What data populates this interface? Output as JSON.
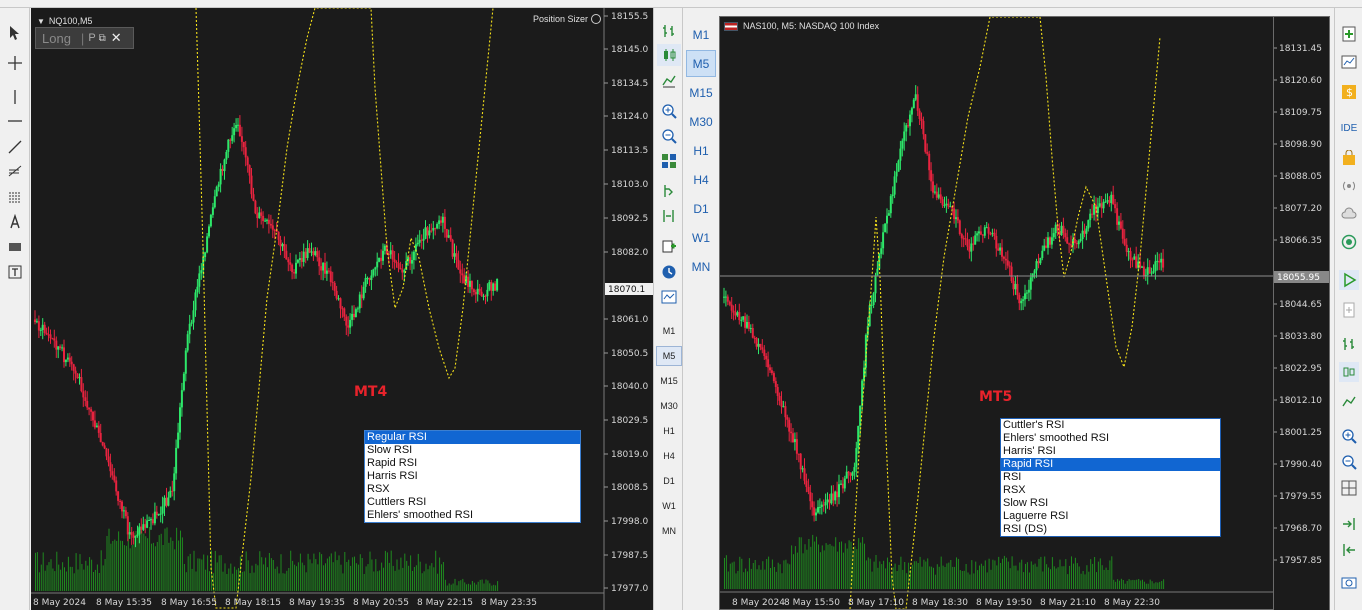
{
  "mt4": {
    "symbol_title": "NQ100,M5",
    "position_sizer": "Position Sizer",
    "panel": {
      "direction": "Long",
      "mode": "P"
    },
    "watermark": "MT4",
    "current_price": "18070.1",
    "price_axis": [
      "18155.5",
      "18145.0",
      "18134.5",
      "18124.0",
      "18113.5",
      "18103.0",
      "18092.5",
      "18082.0",
      "18061.0",
      "18050.5",
      "18040.0",
      "18029.5",
      "18019.0",
      "18008.5",
      "17998.0",
      "17987.5",
      "17977.0"
    ],
    "time_axis": [
      "8 May 2024",
      "8 May 15:35",
      "8 May 16:55",
      "8 May 18:15",
      "8 May 19:35",
      "8 May 20:55",
      "8 May 22:15",
      "8 May 23:35"
    ],
    "timeframes": [
      "M1",
      "M5",
      "M15",
      "M30",
      "H1",
      "H4",
      "D1",
      "W1",
      "MN"
    ],
    "active_timeframe": "M5",
    "rsi_list": [
      "Regular RSI",
      "Slow RSI",
      "Rapid RSI",
      "Harris RSI",
      "RSX",
      "Cuttlers RSI",
      "Ehlers' smoothed RSI"
    ],
    "rsi_selected": "Regular RSI"
  },
  "mt5": {
    "symbol_title": "NAS100, M5:  NASDAQ 100 Index",
    "watermark": "MT5",
    "current_price": "18055.95",
    "price_axis": [
      "18131.45",
      "18120.60",
      "18109.75",
      "18098.90",
      "18088.05",
      "18077.20",
      "18066.35",
      "18044.65",
      "18033.80",
      "18022.95",
      "18012.10",
      "18001.25",
      "17990.40",
      "17979.55",
      "17968.70",
      "17957.85"
    ],
    "time_axis": [
      "8 May 2024",
      "8 May 15:50",
      "8 May 17:10",
      "8 May 18:30",
      "8 May 19:50",
      "8 May 21:10",
      "8 May 22:30"
    ],
    "timeframes": [
      "M1",
      "M5",
      "M15",
      "M30",
      "H1",
      "H4",
      "D1",
      "W1",
      "MN"
    ],
    "active_timeframe": "M5",
    "rsi_list": [
      "Cuttler's RSI",
      "Ehlers' smoothed RSI",
      "Harris' RSI",
      "Rapid RSI",
      "RSI",
      "RSX",
      "Slow RSI",
      "Laguerre RSI",
      "RSI (DS)"
    ],
    "rsi_selected": "Rapid RSI"
  },
  "right_toolbar": {
    "ide_label": "IDE"
  },
  "colors": {
    "bull": "#2de86a",
    "bear": "#e8233f",
    "rsi_line": "#f5e11a",
    "volume": "#1f8a1f",
    "chart_bg": "#1b1b1b",
    "accent": "#1166d2"
  }
}
